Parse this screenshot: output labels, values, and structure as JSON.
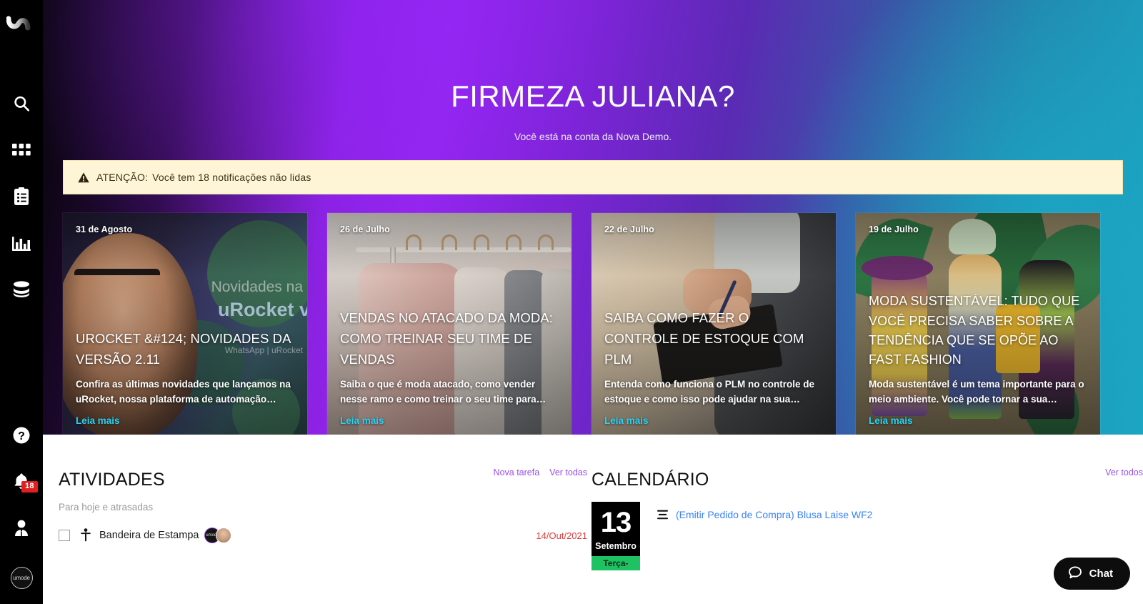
{
  "sidebar": {
    "logo_name": "umode-logo",
    "items": [
      {
        "icon": "search-icon",
        "label": "Buscar"
      },
      {
        "icon": "grid-apps-icon",
        "label": "Aplicativos"
      },
      {
        "icon": "clipboard-icon",
        "label": "Tarefas"
      },
      {
        "icon": "bar-chart-icon",
        "label": "Relatórios"
      },
      {
        "icon": "database-icon",
        "label": "Dados"
      }
    ],
    "bottom_items": [
      {
        "icon": "help-icon",
        "label": "Ajuda"
      },
      {
        "icon": "bell-icon",
        "label": "Notificações",
        "badge": "18"
      },
      {
        "icon": "user-tie-icon",
        "label": "Perfil"
      }
    ],
    "account_avatar_text": "umode"
  },
  "hero": {
    "title": "FIRMEZA JULIANA?",
    "subtitle": "Você está na conta da Nova Demo."
  },
  "alert": {
    "icon": "warning-triangle-icon",
    "label": "ATENÇÃO:",
    "message": "Você tem 18 notificações não lidas"
  },
  "cards": [
    {
      "date": "31 de Agosto",
      "title": "UROCKET &#124; NOVIDADES DA VERSÃO 2.11",
      "desc": "Confira as últimas novidades que lançamos na uRocket, nossa plataforma de automação…",
      "link": "Leia mais",
      "art_text_1": "Novidades na",
      "art_text_2": "uRocket v",
      "art_text_3": "WhatsApp  |  uRocket"
    },
    {
      "date": "26 de Julho",
      "title": "VENDAS NO ATACADO DA MODA: COMO TREINAR SEU TIME DE VENDAS",
      "desc": "Saiba o que é moda atacado, como vender nesse ramo e como treinar o seu time para…",
      "link": "Leia mais"
    },
    {
      "date": "22 de Julho",
      "title": "SAIBA COMO FAZER O CONTROLE DE ESTOQUE COM PLM",
      "desc": "Entenda como funciona o PLM no controle de estoque e como isso pode ajudar na sua…",
      "link": "Leia mais"
    },
    {
      "date": "19 de Julho",
      "title": "MODA SUSTENTÁVEL: TUDO QUE VOCÊ PRECISA SABER SOBRE A TENDÊNCIA QUE SE OPÕE AO FAST FASHION",
      "desc": "Moda sustentável é um tema importante para o meio ambiente. Você pode tornar a sua…",
      "link": "Leia mais"
    }
  ],
  "activities": {
    "title": "ATIVIDADES",
    "new_task_label": "Nova tarefa",
    "view_all_label": "Ver todas",
    "group_label": "Para hoje e atrasadas",
    "tasks": [
      {
        "name": "Bandeira de Estampa",
        "date": "14/Out/2021",
        "icon": "person-accessibility-icon",
        "avatars": [
          "umode",
          ""
        ]
      }
    ]
  },
  "calendar": {
    "title": "CALENDÁRIO",
    "view_all_label": "Ver todos",
    "events": [
      {
        "day": "13",
        "month": "Setembro",
        "weekday": "Terça-",
        "icon": "list-lines-icon",
        "text": "(Emitir Pedido de Compra) Blusa Laise WF2"
      }
    ]
  },
  "chat": {
    "label": "Chat",
    "icon": "chat-bubble-icon"
  },
  "colors": {
    "accent_purple": "#9b4dea",
    "link_blue": "#3b82f6",
    "card_link_cyan": "#27d3f5",
    "alert_bg": "#fdf5d5",
    "badge_red": "#e02020",
    "date_red": "#e23c3c",
    "calendar_green": "#1fc263"
  }
}
